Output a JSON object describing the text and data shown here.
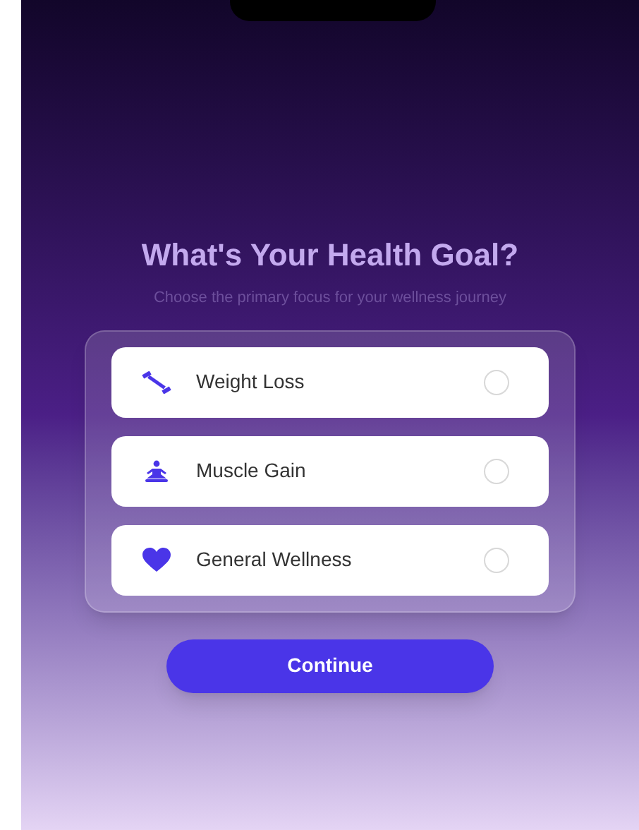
{
  "title": "What's Your Health Goal?",
  "subtitle": "Choose the primary focus for your wellness journey",
  "options": [
    {
      "kind": "dumbbell",
      "label": "Weight Loss",
      "selected": false
    },
    {
      "kind": "meditation",
      "label": "Muscle Gain",
      "selected": false
    },
    {
      "kind": "heart",
      "label": "General Wellness",
      "selected": false
    }
  ],
  "continue_button": "Continue"
}
